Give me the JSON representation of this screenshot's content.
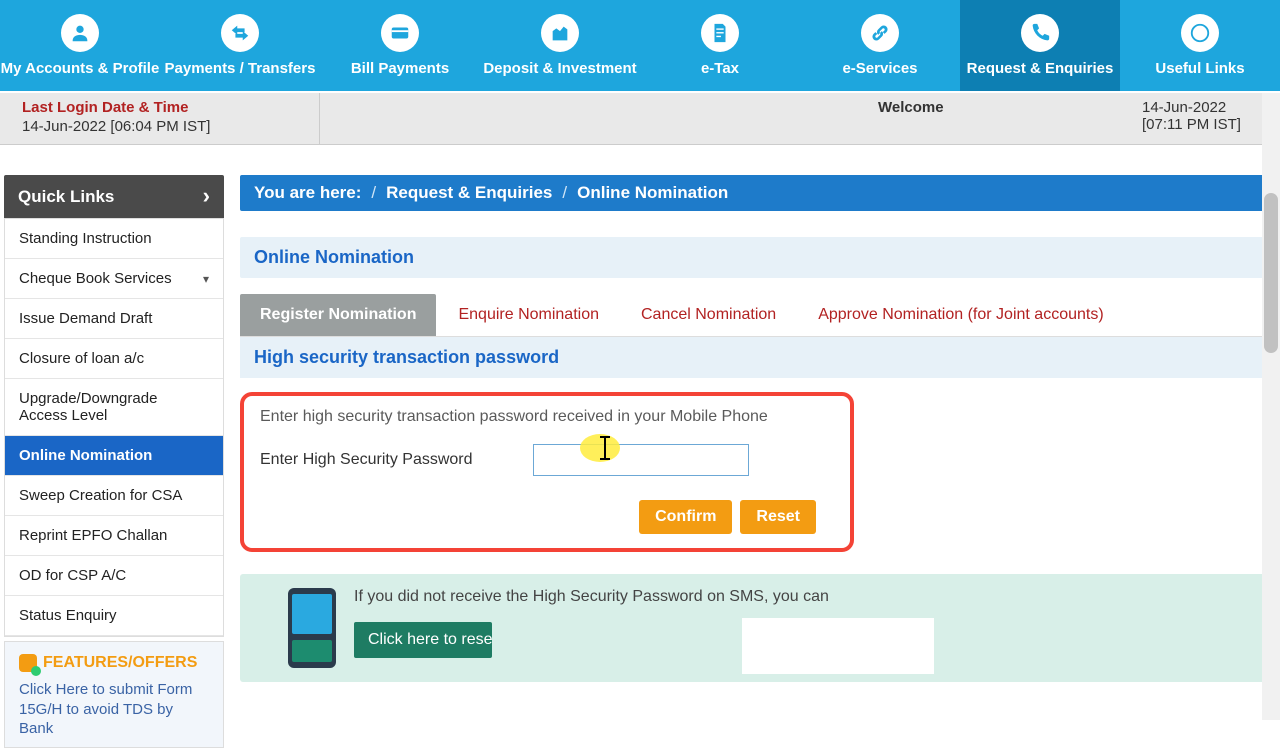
{
  "topnav": [
    {
      "label": "My Accounts & Profile"
    },
    {
      "label": "Payments / Transfers"
    },
    {
      "label": "Bill Payments"
    },
    {
      "label": "Deposit & Investment"
    },
    {
      "label": "e-Tax"
    },
    {
      "label": "e-Services"
    },
    {
      "label": "Request & Enquiries"
    },
    {
      "label": "Useful Links"
    }
  ],
  "infobar": {
    "last_login_title": "Last Login Date & Time",
    "last_login_value": "14-Jun-2022 [06:04 PM IST]",
    "welcome": "Welcome",
    "now_date": "14-Jun-2022",
    "now_time": "[07:11 PM IST]"
  },
  "quicklinks": {
    "header": "Quick Links",
    "items": [
      "Standing Instruction",
      "Cheque Book Services",
      "Issue Demand Draft",
      "Closure of loan a/c",
      "Upgrade/Downgrade Access Level",
      "Online Nomination",
      "Sweep Creation for CSA",
      "Reprint EPFO Challan",
      "OD for CSP A/C",
      "Status Enquiry"
    ],
    "features_title": "FEATURES/OFFERS",
    "features_line": "Click Here to submit Form 15G/H to avoid TDS by Bank"
  },
  "breadcrumb": {
    "prefix": "You are here:",
    "a": "Request & Enquiries",
    "b": "Online Nomination"
  },
  "page": {
    "title": "Online Nomination",
    "tabs": [
      "Register Nomination",
      "Enquire Nomination",
      "Cancel Nomination",
      "Approve Nomination (for Joint accounts)"
    ],
    "subtitle": "High security transaction password",
    "instruction": "Enter high security transaction password received in your Mobile Phone",
    "otp_label": "Enter High Security Password",
    "confirm": "Confirm",
    "reset": "Reset",
    "resend_text": "If you did not receive the High Security Password on SMS, you can",
    "resend_btn": "Click here to resend"
  }
}
